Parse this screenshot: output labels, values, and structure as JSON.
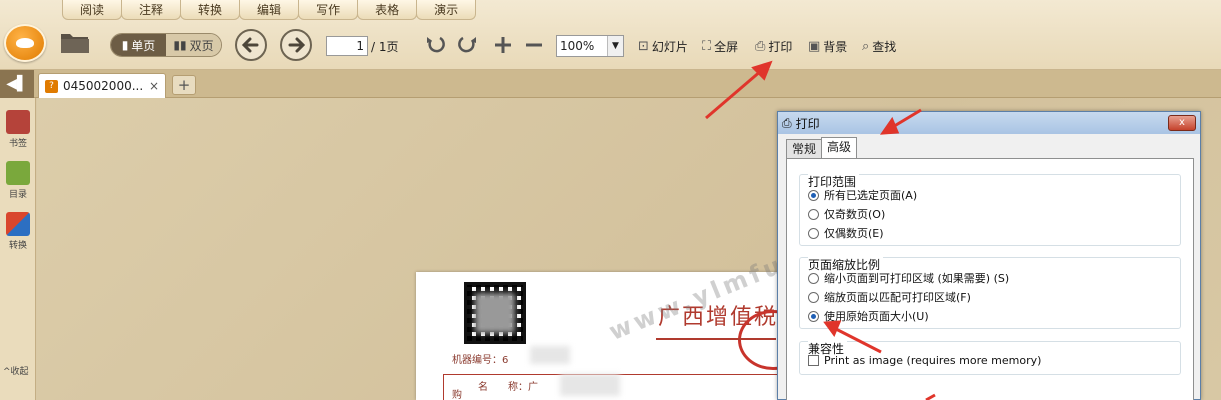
{
  "menu": {
    "tabs": [
      "阅读",
      "注释",
      "转换",
      "编辑",
      "写作",
      "表格",
      "演示"
    ]
  },
  "toolbar": {
    "single_page": "单页",
    "double_page": "双页",
    "page_current": "1",
    "page_total": "/ 1页",
    "zoom": "100%",
    "slideshow": "幻灯片",
    "fullscreen": "全屏",
    "print": "打印",
    "background": "背景",
    "find": "查找"
  },
  "tabs": {
    "doc_tab": "045002000...",
    "close": "×",
    "add": "+"
  },
  "sidebar": {
    "bookmark": "书签",
    "toc": "目录",
    "convert": "转换",
    "collapse": "收起"
  },
  "document": {
    "title": "广西增值税",
    "machine_no": "机器编号：6",
    "row_label": "购",
    "field_name": "名　　称：广",
    "watermark": "www.ylmfu.cn"
  },
  "dialog": {
    "title": "打印",
    "close": "x",
    "tabs": [
      "常规",
      "高级"
    ],
    "print_range": {
      "title": "打印范围",
      "options": [
        "所有已选定页面(A)",
        "仅奇数页(O)",
        "仅偶数页(E)"
      ]
    },
    "page_scale": {
      "title": "页面缩放比例",
      "options": [
        "缩小页面到可打印区域 (如果需要) (S)",
        "缩放页面以匹配可打印区域(F)",
        "使用原始页面大小(U)"
      ]
    },
    "compat": {
      "title": "兼容性",
      "option": "Print as image (requires more memory)"
    }
  },
  "colors": {
    "accent_red": "#e0352b",
    "toolbar_bg": "#efe3c8",
    "dialog_title": "#b7cfe9"
  }
}
